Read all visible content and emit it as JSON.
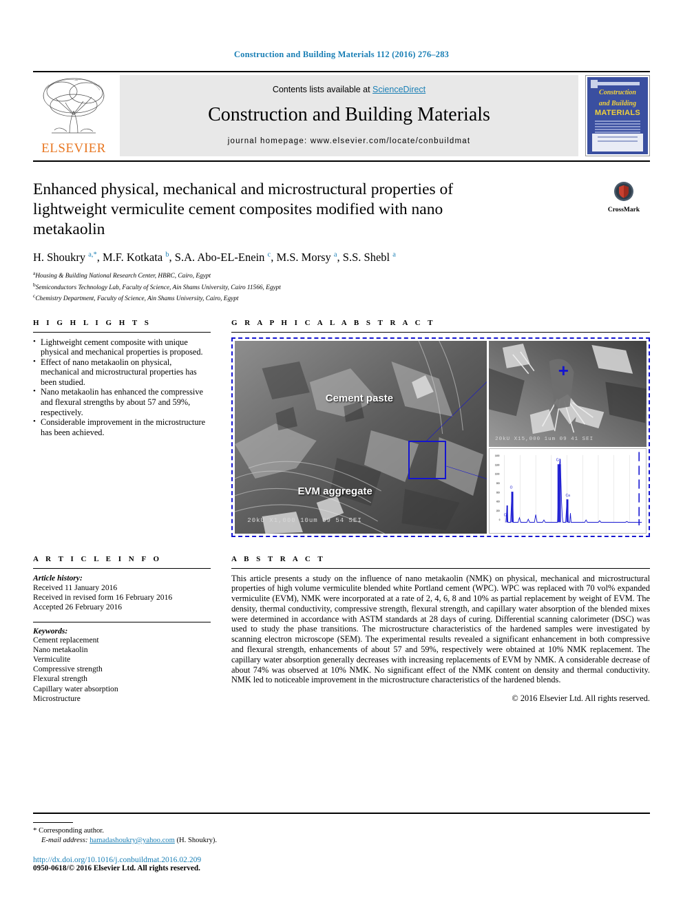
{
  "running_head": "Construction and Building Materials 112 (2016) 276–283",
  "masthead": {
    "publisher": "ELSEVIER",
    "contents_prefix": "Contents lists available at ",
    "contents_link": "ScienceDirect",
    "journal_title": "Construction and Building Materials",
    "homepage": "journal homepage: www.elsevier.com/locate/conbuildmat",
    "cover": {
      "line1": "Construction",
      "line2": "and Building",
      "line3": "MATERIALS",
      "blurb": "An international journal dedicated to the investigation and innovative use of materials in construction and repair",
      "footer": "Elsevier"
    }
  },
  "article": {
    "title": "Enhanced physical, mechanical and microstructural properties of lightweight vermiculite cement composites modified with nano metakaolin",
    "authors_html": "H. Shoukry <sup>a,*</sup>, M.F. Kotkata <sup>b</sup>, S.A. Abo-EL-Enein <sup>c</sup>, M.S. Morsy <sup>a</sup>, S.S. Shebl <sup>a</sup>",
    "affiliations": [
      {
        "marker": "a",
        "text": "Housing & Building National Research Center, HBRC, Cairo, Egypt"
      },
      {
        "marker": "b",
        "text": "Semiconductors Technology Lab, Faculty of Science, Ain Shams University, Cairo 11566, Egypt"
      },
      {
        "marker": "c",
        "text": "Chemistry Department, Faculty of Science, Ain Shams University, Cairo, Egypt"
      }
    ],
    "crossmark_label": "CrossMark"
  },
  "highlights": {
    "heading": "H I G H L I G H T S",
    "items": [
      "Lightweight cement composite with unique physical and mechanical properties is proposed.",
      "Effect of nano metakaolin on physical, mechanical and microstructural properties has been studied.",
      "Nano metakaolin has enhanced the compressive and flexural strengths by about 57 and 59%, respectively.",
      "Considerable improvement in the microstructure has been achieved."
    ]
  },
  "graphical_abstract": {
    "heading": "G R A P H I C A L   A B S T R A C T",
    "label_cement_paste": "Cement paste",
    "label_evm_aggregate": "EVM aggregate",
    "scalebar_left": "20kU    X1,000    10um         09 54 SEI",
    "scalebar_right": "20kU   X15,000    1um      09 41 SEI",
    "marker_plus": "+",
    "eds_peaks": [
      "C",
      "O",
      "Ca",
      "Ca"
    ]
  },
  "article_info": {
    "heading": "A R T I C L E   I N F O",
    "history_label": "Article history:",
    "history": [
      "Received 11 January 2016",
      "Received in revised form 16 February 2016",
      "Accepted 26 February 2016"
    ],
    "keywords_label": "Keywords:",
    "keywords": [
      "Cement replacement",
      "Nano metakaolin",
      "Vermiculite",
      "Compressive strength",
      "Flexural strength",
      "Capillary water absorption",
      "Microstructure"
    ]
  },
  "abstract": {
    "heading": "A B S T R A C T",
    "body": "This article presents a study on the influence of nano metakaolin (NMK) on physical, mechanical and microstructural properties of high volume vermiculite blended white Portland cement (WPC). WPC was replaced with 70 vol% expanded vermiculite (EVM), NMK were incorporated at a rate of 2, 4, 6, 8 and 10% as partial replacement by weight of EVM. The density, thermal conductivity, compressive strength, flexural strength, and capillary water absorption of the blended mixes were determined in accordance with ASTM standards at 28 days of curing. Differential scanning calorimeter (DSC) was used to study the phase transitions. The microstructure characteristics of the hardened samples were investigated by scanning electron microscope (SEM). The experimental results revealed a significant enhancement in both compressive and flexural strength, enhancements of about 57 and 59%, respectively were obtained at 10% NMK replacement. The capillary water absorption generally decreases with increasing replacements of EVM by NMK. A considerable decrease of about 74% was observed at 10% NMK. No significant effect of the NMK content on density and thermal conductivity. NMK led to noticeable improvement in the microstructure characteristics of the hardened blends.",
    "copyright": "© 2016 Elsevier Ltd. All rights reserved."
  },
  "footer": {
    "corresponding_marker": "*",
    "corresponding_author": "Corresponding author.",
    "email_label": "E-mail address:",
    "email": "hamadashoukry@yahoo.com",
    "email_suffix": "(H. Shoukry).",
    "doi": "http://dx.doi.org/10.1016/j.conbuildmat.2016.02.209",
    "issn": "0950-0618/© 2016 Elsevier Ltd. All rights reserved."
  },
  "colors": {
    "link_blue": "#1a7fb5",
    "elsevier_orange": "#e87722",
    "figure_border_blue": "#1414d0",
    "cover_blue": "#3a4fa0",
    "cover_yellow": "#f2d23a"
  }
}
